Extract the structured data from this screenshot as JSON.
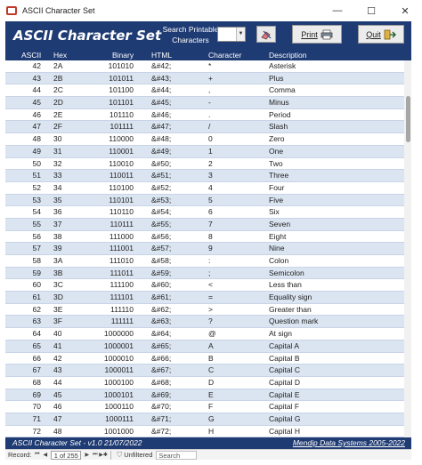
{
  "window": {
    "title": "ASCII Character Set",
    "minimize": "—",
    "maximize": "☐",
    "close": "✕"
  },
  "header": {
    "heading": "ASCII Character Set",
    "search_label": "Search Printable Characters",
    "search_value": "",
    "print_label": "Print",
    "quit_label": "Quit"
  },
  "columns": {
    "ascii": "ASCII",
    "hex": "Hex",
    "binary": "Binary",
    "html": "HTML",
    "character": "Character",
    "description": "Description"
  },
  "rows": [
    {
      "ascii": "42",
      "hex": "2A",
      "binary": "101010",
      "html": "&#42;",
      "char": "*",
      "desc": "Asterisk"
    },
    {
      "ascii": "43",
      "hex": "2B",
      "binary": "101011",
      "html": "&#43;",
      "char": "+",
      "desc": "Plus"
    },
    {
      "ascii": "44",
      "hex": "2C",
      "binary": "101100",
      "html": "&#44;",
      "char": ",",
      "desc": "Comma"
    },
    {
      "ascii": "45",
      "hex": "2D",
      "binary": "101101",
      "html": "&#45;",
      "char": "-",
      "desc": "Minus"
    },
    {
      "ascii": "46",
      "hex": "2E",
      "binary": "101110",
      "html": "&#46;",
      "char": ".",
      "desc": "Period"
    },
    {
      "ascii": "47",
      "hex": "2F",
      "binary": "101111",
      "html": "&#47;",
      "char": "/",
      "desc": "Slash"
    },
    {
      "ascii": "48",
      "hex": "30",
      "binary": "110000",
      "html": "&#48;",
      "char": "0",
      "desc": "Zero"
    },
    {
      "ascii": "49",
      "hex": "31",
      "binary": "110001",
      "html": "&#49;",
      "char": "1",
      "desc": "One"
    },
    {
      "ascii": "50",
      "hex": "32",
      "binary": "110010",
      "html": "&#50;",
      "char": "2",
      "desc": "Two"
    },
    {
      "ascii": "51",
      "hex": "33",
      "binary": "110011",
      "html": "&#51;",
      "char": "3",
      "desc": "Three"
    },
    {
      "ascii": "52",
      "hex": "34",
      "binary": "110100",
      "html": "&#52;",
      "char": "4",
      "desc": "Four"
    },
    {
      "ascii": "53",
      "hex": "35",
      "binary": "110101",
      "html": "&#53;",
      "char": "5",
      "desc": "Five"
    },
    {
      "ascii": "54",
      "hex": "36",
      "binary": "110110",
      "html": "&#54;",
      "char": "6",
      "desc": "Six"
    },
    {
      "ascii": "55",
      "hex": "37",
      "binary": "110111",
      "html": "&#55;",
      "char": "7",
      "desc": "Seven"
    },
    {
      "ascii": "56",
      "hex": "38",
      "binary": "111000",
      "html": "&#56;",
      "char": "8",
      "desc": "Eight"
    },
    {
      "ascii": "57",
      "hex": "39",
      "binary": "111001",
      "html": "&#57;",
      "char": "9",
      "desc": "Nine"
    },
    {
      "ascii": "58",
      "hex": "3A",
      "binary": "111010",
      "html": "&#58;",
      "char": ":",
      "desc": "Colon"
    },
    {
      "ascii": "59",
      "hex": "3B",
      "binary": "111011",
      "html": "&#59;",
      "char": ";",
      "desc": "Semicolon"
    },
    {
      "ascii": "60",
      "hex": "3C",
      "binary": "111100",
      "html": "&#60;",
      "char": "<",
      "desc": "Less than"
    },
    {
      "ascii": "61",
      "hex": "3D",
      "binary": "111101",
      "html": "&#61;",
      "char": "=",
      "desc": "Equality sign"
    },
    {
      "ascii": "62",
      "hex": "3E",
      "binary": "111110",
      "html": "&#62;",
      "char": ">",
      "desc": "Greater than"
    },
    {
      "ascii": "63",
      "hex": "3F",
      "binary": "111111",
      "html": "&#63;",
      "char": "?",
      "desc": "Question mark"
    },
    {
      "ascii": "64",
      "hex": "40",
      "binary": "1000000",
      "html": "&#64;",
      "char": "@",
      "desc": "At sign"
    },
    {
      "ascii": "65",
      "hex": "41",
      "binary": "1000001",
      "html": "&#65;",
      "char": "A",
      "desc": "Capital A"
    },
    {
      "ascii": "66",
      "hex": "42",
      "binary": "1000010",
      "html": "&#66;",
      "char": "B",
      "desc": "Capital B"
    },
    {
      "ascii": "67",
      "hex": "43",
      "binary": "1000011",
      "html": "&#67;",
      "char": "C",
      "desc": "Capital C"
    },
    {
      "ascii": "68",
      "hex": "44",
      "binary": "1000100",
      "html": "&#68;",
      "char": "D",
      "desc": "Capital D"
    },
    {
      "ascii": "69",
      "hex": "45",
      "binary": "1000101",
      "html": "&#69;",
      "char": "E",
      "desc": "Capital E"
    },
    {
      "ascii": "70",
      "hex": "46",
      "binary": "1000110",
      "html": "&#70;",
      "char": "F",
      "desc": "Capital F"
    },
    {
      "ascii": "71",
      "hex": "47",
      "binary": "1000111",
      "html": "&#71;",
      "char": "G",
      "desc": "Capital G"
    },
    {
      "ascii": "72",
      "hex": "48",
      "binary": "1001000",
      "html": "&#72;",
      "char": "H",
      "desc": "Capital H"
    }
  ],
  "footer": {
    "left": "ASCII Character Set  - v1.0   21/07/2022",
    "right": "Mendip Data Systems 2005-2022"
  },
  "navbar": {
    "record_label": "Record:",
    "record_value": "1 of 255",
    "filter_label": "Unfiltered",
    "search_label": "Search"
  },
  "colors": {
    "header_bg": "#1f3b73",
    "row_alt": "#dbe5f1"
  },
  "icons": {
    "print": "printer-icon",
    "quit": "exit-door-icon",
    "clear": "eraser-icon",
    "filter": "filter-icon"
  }
}
